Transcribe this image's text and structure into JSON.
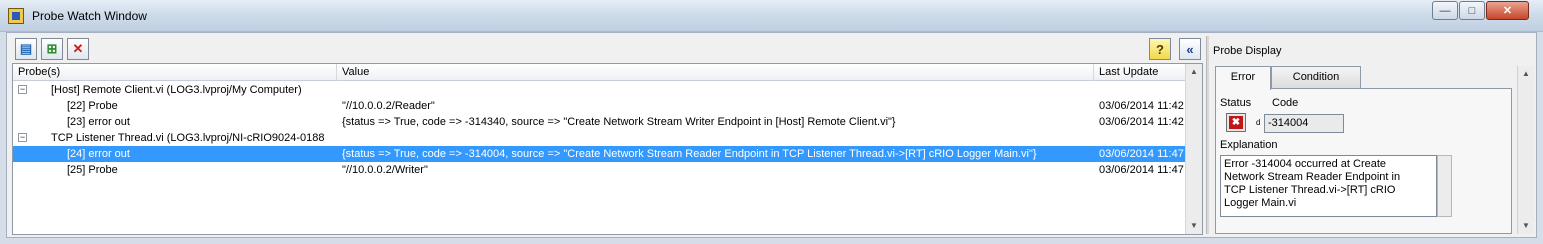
{
  "window": {
    "title": "Probe Watch Window",
    "controls": {
      "minimize": "—",
      "maximize": "□",
      "close": "✕"
    }
  },
  "toolbar": {
    "buttons": [
      {
        "icon": "open-probe-icon",
        "glyph": "▤"
      },
      {
        "icon": "add-probe-icon",
        "glyph": "⊞"
      },
      {
        "icon": "delete-probe-icon",
        "glyph": "✕"
      }
    ],
    "help_glyph": "?",
    "collapse_glyph": "«"
  },
  "table": {
    "columns": [
      "Probe(s)",
      "Value",
      "Last Update"
    ],
    "rows": [
      {
        "indent": 0,
        "expander": "−",
        "probe": "[Host] Remote Client.vi (LOG3.lvproj/My Computer)",
        "value": "",
        "last_update": "",
        "selected": false
      },
      {
        "indent": 1,
        "expander": "",
        "probe": "[22] Probe",
        "value": "\"//10.0.0.2/Reader\"",
        "last_update": "03/06/2014 11:42",
        "selected": false
      },
      {
        "indent": 1,
        "expander": "",
        "probe": "[23] error out",
        "value": "{status => True, code => -314340, source => \"Create Network Stream Writer Endpoint in [Host] Remote Client.vi\"}",
        "last_update": "03/06/2014 11:42",
        "selected": false
      },
      {
        "indent": 0,
        "expander": "−",
        "probe": "TCP Listener Thread.vi (LOG3.lvproj/NI-cRIO9024-0188",
        "value": "",
        "last_update": "",
        "selected": false
      },
      {
        "indent": 1,
        "expander": "",
        "probe": "[24] error out",
        "value": "{status => True, code => -314004, source => \"Create Network Stream Reader Endpoint in TCP Listener Thread.vi->[RT] cRIO Logger Main.vi\"}",
        "last_update": "03/06/2014 11:47",
        "selected": true
      },
      {
        "indent": 1,
        "expander": "",
        "probe": "[25] Probe",
        "value": "\"//10.0.0.2/Writer\"",
        "last_update": "03/06/2014 11:47",
        "selected": false
      }
    ]
  },
  "probe_display": {
    "title": "Probe Display",
    "tabs": [
      "Error",
      "Condition"
    ],
    "status_label": "Status",
    "status_glyph": "✖",
    "code_label": "Code",
    "code_prefix": "d",
    "code_value": "-314004",
    "explanation_label": "Explanation",
    "explanation_lines": [
      "Error -314004 occurred at Create",
      "Network Stream Reader Endpoint in",
      "TCP Listener Thread.vi->[RT] cRIO",
      "Logger Main.vi"
    ]
  }
}
